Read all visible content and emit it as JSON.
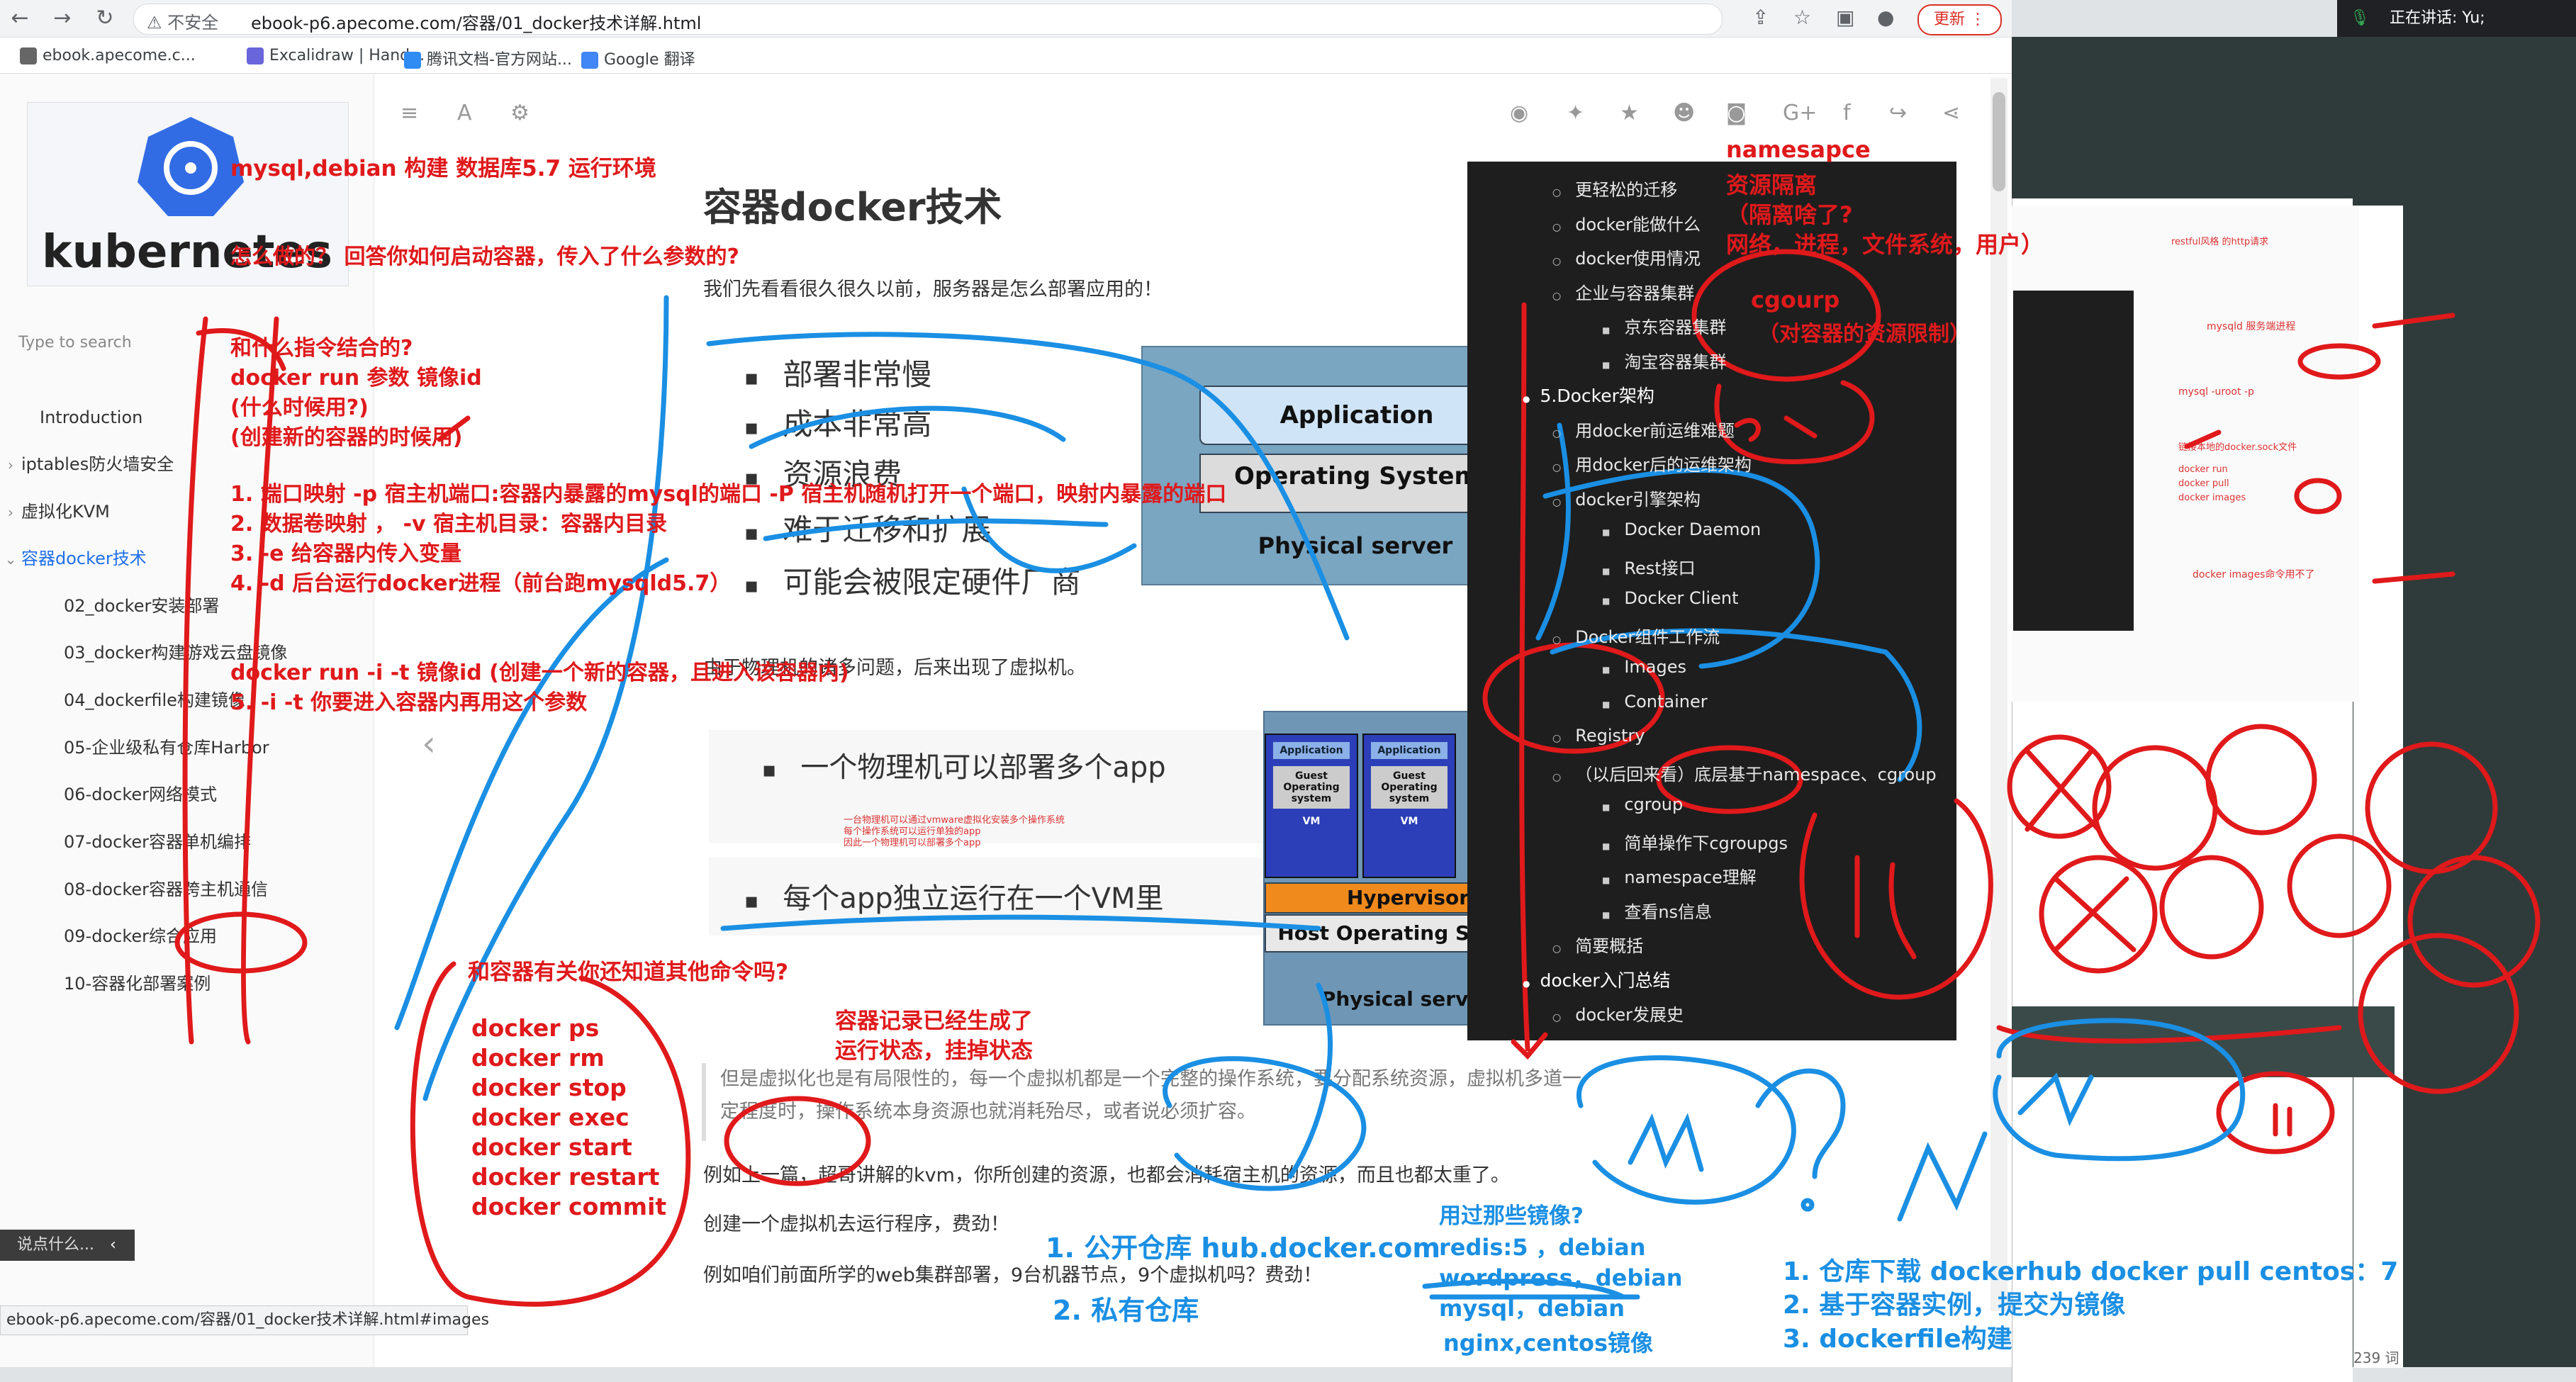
{
  "browser": {
    "url_warning": "⚠ 不安全",
    "url": "ebook-p6.apecome.com/容器/01_docker技术详解.html",
    "update_label": "更新",
    "bookmarks": [
      "ebook.apecome.c...",
      "Excalidraw | Hand...",
      "腾讯文档-官方网站...",
      "Google 翻译"
    ],
    "status_url": "ebook-p6.apecome.com/容器/01_docker技术详解.html#images"
  },
  "meeting": {
    "label": "正在讲话: Yu;"
  },
  "sidebar": {
    "search_placeholder": "Type to search",
    "items": [
      {
        "label": "Introduction",
        "expandable": false
      },
      {
        "label": "iptables防火墙安全",
        "expandable": true
      },
      {
        "label": "虚拟化KVM",
        "expandable": true
      },
      {
        "label": "容器docker技术",
        "expandable": true,
        "active": true
      }
    ],
    "subitems": [
      "02_docker安装部署",
      "03_docker构建游戏云盘镜像",
      "04_dockerfile构建镜像",
      "05-企业级私有仓库Harbor",
      "06-docker网络模式",
      "07-docker容器单机编排",
      "08-docker容器跨主机通信",
      "09-docker综合应用",
      "10-容器化部署案例"
    ],
    "ask_label": "说点什么...",
    "ask_chevron": "‹"
  },
  "article": {
    "title": "容器docker技术",
    "intro": "我们先看看很久很久以前，服务器是怎么部署应用的！",
    "bullets1": [
      "部署非常慢",
      "成本非常高",
      "资源浪费",
      "难于迁移和扩展",
      "可能会被限定硬件厂商"
    ],
    "diagram1": {
      "app": "Application",
      "os": "Operating System",
      "server": "Physical server"
    },
    "vm_intro": "由于物理机的诸多问题，后来出现了虚拟机。",
    "bullets2": [
      "一个物理机可以部署多个app",
      "每个app独立运行在一个VM里"
    ],
    "small_note": [
      "一台物理机可以通过vmware虚拟化安装多个操作系统",
      "每个操作系统可以运行单独的app",
      "因此一个物理机可以部署多个app"
    ],
    "diagram2": {
      "vm_app": "Application",
      "vm_guest": "Guest Operating system",
      "vm_label": "VM",
      "hypervisor": "Hypervisor",
      "host_os": "Host Operating System",
      "server": "Physical server"
    },
    "quote": [
      "但是虚拟化也是有局限性的，每一个虚拟机都是一个完整的操作系统，要分配系统资源，虚拟机多道一",
      "定程度时，操作系统本身资源也就消耗殆尽，或者说必须扩容。"
    ],
    "p1": "例如上一篇，超哥讲解的kvm，你所创建的资源，也都会消耗宿主机的资源，而且也都太重了。",
    "p2": "创建一个虚拟机去运行程序，费劲！",
    "p3": "例如咱们前面所学的web集群部署，9台机器节点，9个虚拟机吗？费劲！",
    "word_count": "239 词"
  },
  "toc": {
    "items": [
      {
        "level": 1,
        "text": "更轻松的迁移"
      },
      {
        "level": 1,
        "text": "docker能做什么"
      },
      {
        "level": 1,
        "text": "docker使用情况"
      },
      {
        "level": 1,
        "text": "企业与容器集群"
      },
      {
        "level": 2,
        "text": "京东容器集群"
      },
      {
        "level": 2,
        "text": "淘宝容器集群"
      },
      {
        "level": 0,
        "text": "5.Docker架构"
      },
      {
        "level": 1,
        "text": "用docker前运维难题"
      },
      {
        "level": 1,
        "text": "用docker后的运维架构"
      },
      {
        "level": 1,
        "text": "docker引擎架构"
      },
      {
        "level": 2,
        "text": "Docker Daemon"
      },
      {
        "level": 2,
        "text": "Rest接口"
      },
      {
        "level": 2,
        "text": "Docker Client"
      },
      {
        "level": 1,
        "text": "Docker组件工作流"
      },
      {
        "level": 2,
        "text": "Images"
      },
      {
        "level": 2,
        "text": "Container"
      },
      {
        "level": 1,
        "text": "Registry"
      },
      {
        "level": 1,
        "text": "（以后回来看）底层基于namespace、cgroup"
      },
      {
        "level": 2,
        "text": "cgroup"
      },
      {
        "level": 2,
        "text": "简单操作下cgroupgs"
      },
      {
        "level": 2,
        "text": "namespace理解"
      },
      {
        "level": 2,
        "text": "查看ns信息"
      },
      {
        "level": 1,
        "text": "简要概括"
      },
      {
        "level": 0,
        "text": "docker入门总结"
      },
      {
        "level": 1,
        "text": "docker发展史"
      }
    ]
  },
  "annotations": {
    "red": [
      "mysql,debian 构建 数据库5.7  运行环境",
      "怎么做的？  回答你如何启动容器，传入了什么参数的?",
      "和什么指令结合的?",
      "docker  run 参数 镜像id",
      "(什么时候用?)",
      "(创建新的容器的时候用)",
      "1. 端口映射   -p 宿主机端口:容器内暴露的mysql的端口  -P 宿主机随机打开一个端口，映射内暴露的端口",
      "2. 数据卷映射  ，  -v 宿主机目录：容器内目录",
      "3. -e  给容器内传入变量",
      "4. -d  后台运行docker进程（前台跑mysqld5.7）",
      "docker run -i -t  镜像id   (创建一个新的容器，且进入该容器内)",
      "5. -i -t 你要进入容器内再用这个参数",
      "和容器有关你还知道其他命令吗?",
      "容器记录已经生成了",
      "运行状态，挂掉状态",
      "namesapce",
      "资源隔离",
      "（隔离啥了?",
      "网络，进程，文件系统，用户）",
      "cgourp",
      "（对容器的资源限制）"
    ],
    "commands": [
      "docker ps",
      "docker rm",
      "docker stop",
      "docker exec",
      "docker start",
      "docker restart",
      "docker commit"
    ],
    "blue": [
      "1. 公开仓库    hub.docker.com",
      "2. 私有仓库",
      "用过那些镜像?",
      "redis:5  ，debian",
      "wordpress，debian",
      "mysql，debian",
      "nginx,centos镜像",
      "1. 仓库下载  dockerhub  docker  pull centos：7",
      "2.  基于容器实例，提交为镜像",
      "3. dockerfile构建"
    ],
    "thumb_labels": [
      "restful风格 的http请求",
      "mysqld 服务端进程",
      "mysql -uroot -p",
      "链接本地的docker.sock文件",
      "docker run",
      "docker pull",
      "docker images",
      "docker images命令用不了"
    ]
  },
  "colors": {
    "annotation_red": "#e0191b",
    "annotation_blue": "#1a8fe3",
    "active_link": "#1f6feb",
    "toc_bg": "#1e1e1e"
  }
}
